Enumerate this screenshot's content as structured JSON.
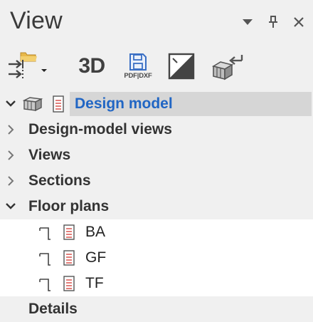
{
  "panel": {
    "title": "View",
    "header_icons": [
      "dropdown-triangle-icon",
      "pin-icon",
      "close-icon"
    ]
  },
  "toolbar": {
    "buttons": [
      {
        "name": "open-folder-import",
        "icon": "folder-arrow-icon",
        "has_dropdown": true
      },
      {
        "name": "3d",
        "label": "3D"
      },
      {
        "name": "pdf-dxf-export",
        "icon": "floppy-disk-icon",
        "label": "PDF|DXF"
      },
      {
        "name": "section-view",
        "icon": "section-icon"
      },
      {
        "name": "import-model",
        "icon": "import-model-icon"
      }
    ]
  },
  "tree": {
    "items": [
      {
        "label": "Design model",
        "expanded": true,
        "selected": true,
        "icons": [
          "model-cube-icon",
          "document-icon"
        ]
      },
      {
        "label": "Design-model views",
        "expanded": false
      },
      {
        "label": "Views",
        "expanded": false
      },
      {
        "label": "Sections",
        "expanded": false
      },
      {
        "label": "Floor plans",
        "expanded": true,
        "children": [
          {
            "label": "BA",
            "icons": [
              "floor-plan-icon",
              "document-icon"
            ]
          },
          {
            "label": "GF",
            "icons": [
              "floor-plan-icon",
              "document-icon"
            ]
          },
          {
            "label": "TF",
            "icons": [
              "floor-plan-icon",
              "document-icon"
            ]
          }
        ]
      },
      {
        "label": "Details",
        "expanded": null
      }
    ]
  },
  "colors": {
    "background": "#f0f0f0",
    "selection_bg": "#d6d6d6",
    "selected_text": "#2166c4",
    "document_icon_red": "#d9534f",
    "folder_yellow": "#e8b84a",
    "save_icon_blue": "#3a6fc4"
  }
}
